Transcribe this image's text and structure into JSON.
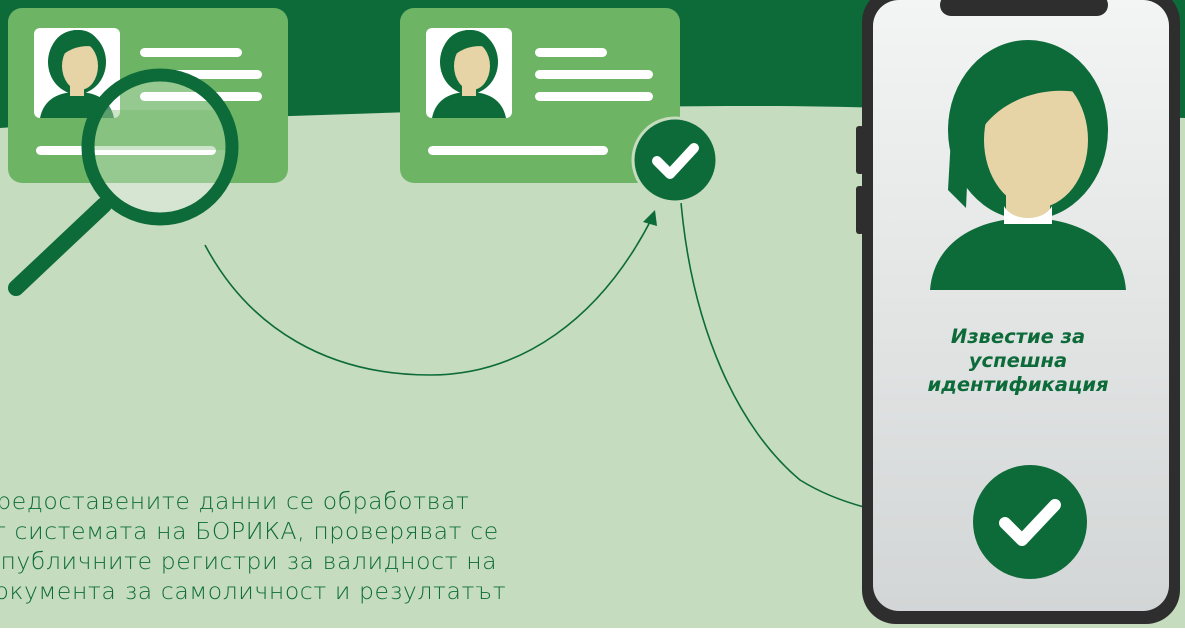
{
  "notification": {
    "lines": [
      "Известие за",
      "успешна",
      "идентификация"
    ]
  },
  "description": {
    "lines": [
      "Предоставените данни се обработват",
      "от системата на БОРИКА, проверяват се",
      "в публичните регистри за валидност на",
      "документа за самоличност и резултатът"
    ]
  },
  "colors": {
    "dark_green": "#0d6b3a",
    "mid_green": "#6db565",
    "light_green_bg": "#c6dcbf",
    "skin": "#e6d4a6",
    "phone_frame": "#2e2e2e"
  },
  "icons": [
    "magnifier-icon",
    "check-icon",
    "person-avatar-icon"
  ]
}
